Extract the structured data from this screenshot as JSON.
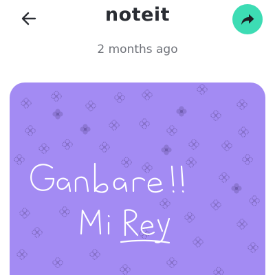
{
  "header": {
    "back_icon": "arrow-left-icon",
    "title": "noteit",
    "share_icon": "share-arrow-icon",
    "share_color": "#3ddcb4"
  },
  "note": {
    "timestamp": "2 months ago",
    "background_color": "#a38bf3",
    "ink_color": "#ffffff",
    "handwritten_lines": [
      "Ganbare!!",
      "Mi Rey"
    ]
  }
}
